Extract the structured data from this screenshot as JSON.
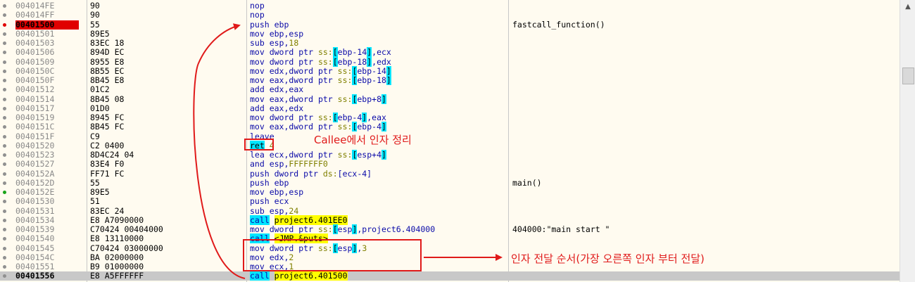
{
  "rows": [
    {
      "addr": "004014FE",
      "bytes": "90",
      "dis": [
        [
          "mn",
          "nop"
        ]
      ],
      "comment": "",
      "marker": "gray"
    },
    {
      "addr": "004014FF",
      "bytes": "90",
      "dis": [
        [
          "mn",
          "nop"
        ]
      ],
      "comment": "",
      "marker": "gray"
    },
    {
      "addr": "00401500",
      "bytes": "55",
      "dis": [
        [
          "mn",
          "push "
        ],
        [
          "reg",
          "ebp"
        ]
      ],
      "comment": "fastcall_function()",
      "marker": "red",
      "addr_hl": true
    },
    {
      "addr": "00401501",
      "bytes": "89E5",
      "dis": [
        [
          "mn",
          "mov "
        ],
        [
          "reg",
          "ebp,esp"
        ]
      ],
      "comment": "",
      "marker": "gray"
    },
    {
      "addr": "00401503",
      "bytes": "83EC 18",
      "dis": [
        [
          "mn",
          "sub "
        ],
        [
          "reg",
          "esp,"
        ],
        [
          "num",
          "18"
        ]
      ],
      "comment": "",
      "marker": "gray"
    },
    {
      "addr": "00401506",
      "bytes": "894D EC",
      "dis": [
        [
          "mn",
          "mov dword ptr "
        ],
        [
          "seg",
          "ss:"
        ],
        [
          "br",
          "["
        ],
        [
          "reg",
          "ebp-14"
        ],
        [
          "br",
          "]"
        ],
        [
          "reg",
          ",ecx"
        ]
      ],
      "comment": "",
      "marker": "gray"
    },
    {
      "addr": "00401509",
      "bytes": "8955 E8",
      "dis": [
        [
          "mn",
          "mov dword ptr "
        ],
        [
          "seg",
          "ss:"
        ],
        [
          "br",
          "["
        ],
        [
          "reg",
          "ebp-18"
        ],
        [
          "br",
          "]"
        ],
        [
          "reg",
          ",edx"
        ]
      ],
      "comment": "",
      "marker": "gray"
    },
    {
      "addr": "0040150C",
      "bytes": "8B55 EC",
      "dis": [
        [
          "mn",
          "mov "
        ],
        [
          "reg",
          "edx,"
        ],
        [
          "mn",
          "dword ptr "
        ],
        [
          "seg",
          "ss:"
        ],
        [
          "br",
          "["
        ],
        [
          "reg",
          "ebp-14"
        ],
        [
          "br",
          "]"
        ]
      ],
      "comment": "",
      "marker": "gray"
    },
    {
      "addr": "0040150F",
      "bytes": "8B45 E8",
      "dis": [
        [
          "mn",
          "mov "
        ],
        [
          "reg",
          "eax,"
        ],
        [
          "mn",
          "dword ptr "
        ],
        [
          "seg",
          "ss:"
        ],
        [
          "br",
          "["
        ],
        [
          "reg",
          "ebp-18"
        ],
        [
          "br",
          "]"
        ]
      ],
      "comment": "",
      "marker": "gray"
    },
    {
      "addr": "00401512",
      "bytes": "01C2",
      "dis": [
        [
          "mn",
          "add "
        ],
        [
          "reg",
          "edx,eax"
        ]
      ],
      "comment": "",
      "marker": "gray"
    },
    {
      "addr": "00401514",
      "bytes": "8B45 08",
      "dis": [
        [
          "mn",
          "mov "
        ],
        [
          "reg",
          "eax,"
        ],
        [
          "mn",
          "dword ptr "
        ],
        [
          "seg",
          "ss:"
        ],
        [
          "br",
          "["
        ],
        [
          "reg",
          "ebp+8"
        ],
        [
          "br",
          "]"
        ]
      ],
      "comment": "",
      "marker": "gray"
    },
    {
      "addr": "00401517",
      "bytes": "01D0",
      "dis": [
        [
          "mn",
          "add "
        ],
        [
          "reg",
          "eax,edx"
        ]
      ],
      "comment": "",
      "marker": "gray"
    },
    {
      "addr": "00401519",
      "bytes": "8945 FC",
      "dis": [
        [
          "mn",
          "mov dword ptr "
        ],
        [
          "seg",
          "ss:"
        ],
        [
          "br",
          "["
        ],
        [
          "reg",
          "ebp-4"
        ],
        [
          "br",
          "]"
        ],
        [
          "reg",
          ",eax"
        ]
      ],
      "comment": "",
      "marker": "gray"
    },
    {
      "addr": "0040151C",
      "bytes": "8B45 FC",
      "dis": [
        [
          "mn",
          "mov "
        ],
        [
          "reg",
          "eax,"
        ],
        [
          "mn",
          "dword ptr "
        ],
        [
          "seg",
          "ss:"
        ],
        [
          "br",
          "["
        ],
        [
          "reg",
          "ebp-4"
        ],
        [
          "br",
          "]"
        ]
      ],
      "comment": "",
      "marker": "gray"
    },
    {
      "addr": "0040151F",
      "bytes": "C9",
      "dis": [
        [
          "mn",
          "leave"
        ]
      ],
      "comment": "",
      "marker": "gray"
    },
    {
      "addr": "00401520",
      "bytes": "C2 0400",
      "dis": [
        [
          "br",
          "ret"
        ],
        [
          "num",
          " 4"
        ]
      ],
      "comment": "",
      "marker": "gray"
    },
    {
      "addr": "00401523",
      "bytes": "8D4C24 04",
      "dis": [
        [
          "mn",
          "lea "
        ],
        [
          "reg",
          "ecx,"
        ],
        [
          "mn",
          "dword ptr "
        ],
        [
          "seg",
          "ss:"
        ],
        [
          "br",
          "["
        ],
        [
          "reg",
          "esp+4"
        ],
        [
          "br",
          "]"
        ]
      ],
      "comment": "",
      "marker": "gray"
    },
    {
      "addr": "00401527",
      "bytes": "83E4 F0",
      "dis": [
        [
          "mn",
          "and "
        ],
        [
          "reg",
          "esp,"
        ],
        [
          "num",
          "FFFFFFF0"
        ]
      ],
      "comment": "",
      "marker": "gray"
    },
    {
      "addr": "0040152A",
      "bytes": "FF71 FC",
      "dis": [
        [
          "mn",
          "push dword ptr "
        ],
        [
          "seg",
          "ds:"
        ],
        [
          "reg",
          "[ecx-4]"
        ]
      ],
      "comment": "",
      "marker": "gray"
    },
    {
      "addr": "0040152D",
      "bytes": "55",
      "dis": [
        [
          "mn",
          "push "
        ],
        [
          "reg",
          "ebp"
        ]
      ],
      "comment": "main()",
      "marker": "gray"
    },
    {
      "addr": "0040152E",
      "bytes": "89E5",
      "dis": [
        [
          "mn",
          "mov "
        ],
        [
          "reg",
          "ebp,esp"
        ]
      ],
      "comment": "",
      "marker": "green"
    },
    {
      "addr": "00401530",
      "bytes": "51",
      "dis": [
        [
          "mn",
          "push "
        ],
        [
          "reg",
          "ecx"
        ]
      ],
      "comment": "",
      "marker": "gray"
    },
    {
      "addr": "00401531",
      "bytes": "83EC 24",
      "dis": [
        [
          "mn",
          "sub "
        ],
        [
          "reg",
          "esp,"
        ],
        [
          "num",
          "24"
        ]
      ],
      "comment": "",
      "marker": "gray"
    },
    {
      "addr": "00401534",
      "bytes": "E8 A7090000",
      "dis": [
        [
          "callhl",
          "call"
        ],
        [
          "mn",
          " "
        ],
        [
          "tgt",
          "project6.401EE0"
        ]
      ],
      "comment": "",
      "marker": "gray"
    },
    {
      "addr": "00401539",
      "bytes": "C70424 00404000",
      "dis": [
        [
          "mn",
          "mov dword ptr "
        ],
        [
          "seg",
          "ss:"
        ],
        [
          "br",
          "["
        ],
        [
          "reg",
          "esp"
        ],
        [
          "br",
          "]"
        ],
        [
          "reg",
          ",project6.404000"
        ]
      ],
      "comment": "404000:\"main start \"",
      "marker": "gray"
    },
    {
      "addr": "00401540",
      "bytes": "E8 13110000",
      "dis": [
        [
          "callhl",
          "call"
        ],
        [
          "mn",
          " "
        ],
        [
          "tgt",
          "<JMP.&puts>"
        ]
      ],
      "comment": "",
      "marker": "gray"
    },
    {
      "addr": "00401545",
      "bytes": "C70424 03000000",
      "dis": [
        [
          "mn",
          "mov dword ptr "
        ],
        [
          "seg",
          "ss:"
        ],
        [
          "br",
          "["
        ],
        [
          "reg",
          "esp"
        ],
        [
          "br",
          "]"
        ],
        [
          "reg",
          ","
        ],
        [
          "num",
          "3"
        ]
      ],
      "comment": "",
      "marker": "gray"
    },
    {
      "addr": "0040154C",
      "bytes": "BA 02000000",
      "dis": [
        [
          "mn",
          "mov "
        ],
        [
          "reg",
          "edx,"
        ],
        [
          "num",
          "2"
        ]
      ],
      "comment": "",
      "marker": "gray"
    },
    {
      "addr": "00401551",
      "bytes": "B9 01000000",
      "dis": [
        [
          "mn",
          "mov "
        ],
        [
          "reg",
          "ecx,"
        ],
        [
          "num",
          "1"
        ]
      ],
      "comment": "",
      "marker": "gray"
    },
    {
      "addr": "00401556",
      "bytes": "E8 A5FFFFFF",
      "dis": [
        [
          "callhl",
          "call"
        ],
        [
          "mn",
          " "
        ],
        [
          "tgt",
          "project6.401500"
        ]
      ],
      "comment": "",
      "marker": "gray",
      "current": true
    }
  ],
  "annotations": {
    "callee_cleanup": "Callee에서 인자 정리",
    "arg_order": "인자 전달 순서(가장 오른쪽 인자 부터 전달)"
  },
  "colors": {
    "annotation": "#e01a1a",
    "breakpoint": "#e00000",
    "bracket": "#00e5ff",
    "call_target": "#ffff00"
  },
  "icons": {
    "scroll_up": "triangle-up"
  }
}
